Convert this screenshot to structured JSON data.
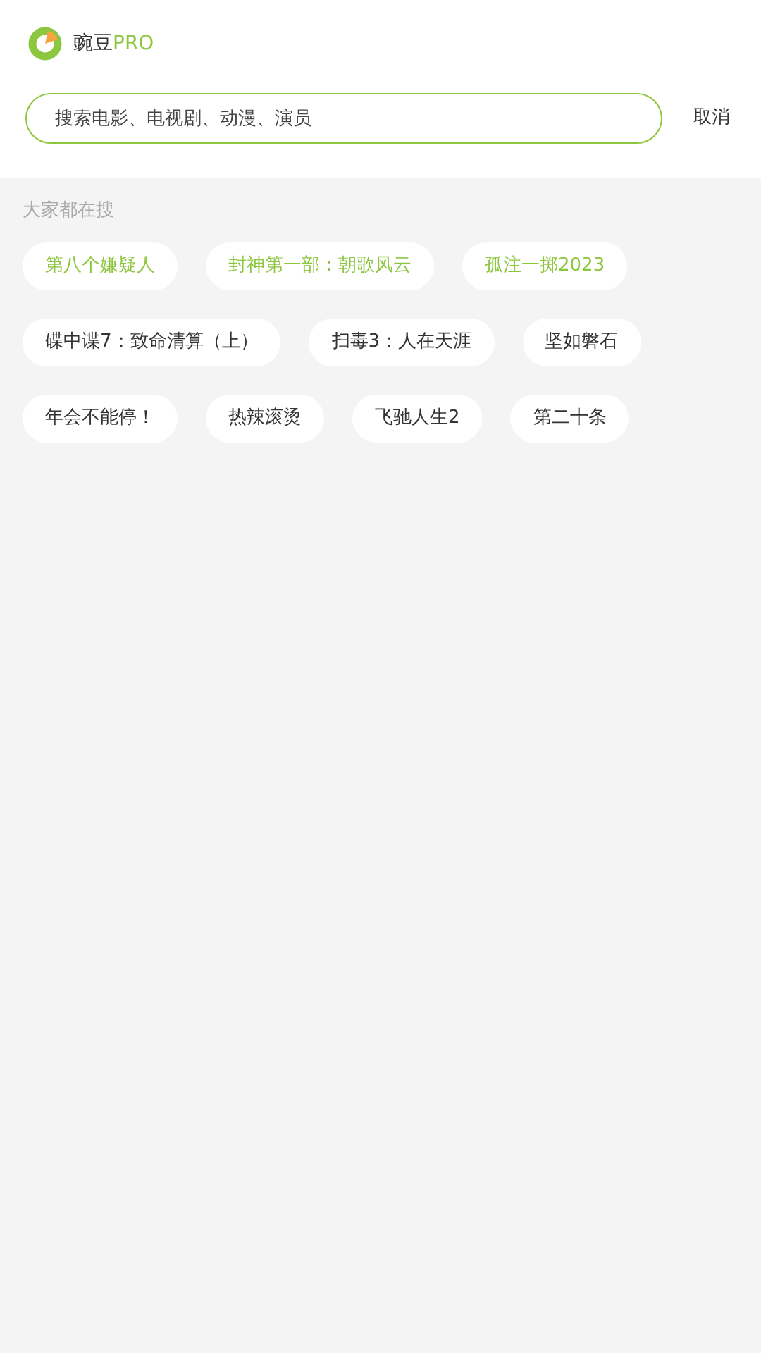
{
  "header": {
    "brand": "豌豆",
    "brand_suffix": "PRO"
  },
  "search": {
    "placeholder": "搜索电影、电视剧、动漫、演员",
    "cancel": "取消"
  },
  "hot_searches": {
    "title": "大家都在搜",
    "tags": [
      {
        "label": "第八个嫌疑人",
        "hot": true
      },
      {
        "label": "封神第一部：朝歌风云",
        "hot": true
      },
      {
        "label": "孤注一掷2023",
        "hot": true
      },
      {
        "label": "碟中谍7：致命清算（上）",
        "hot": false
      },
      {
        "label": "扫毒3：人在天涯",
        "hot": false
      },
      {
        "label": "坚如磐石",
        "hot": false
      },
      {
        "label": "年会不能停！",
        "hot": false
      },
      {
        "label": "热辣滚烫",
        "hot": false
      },
      {
        "label": "飞驰人生2",
        "hot": false
      },
      {
        "label": "第二十条",
        "hot": false
      }
    ]
  }
}
